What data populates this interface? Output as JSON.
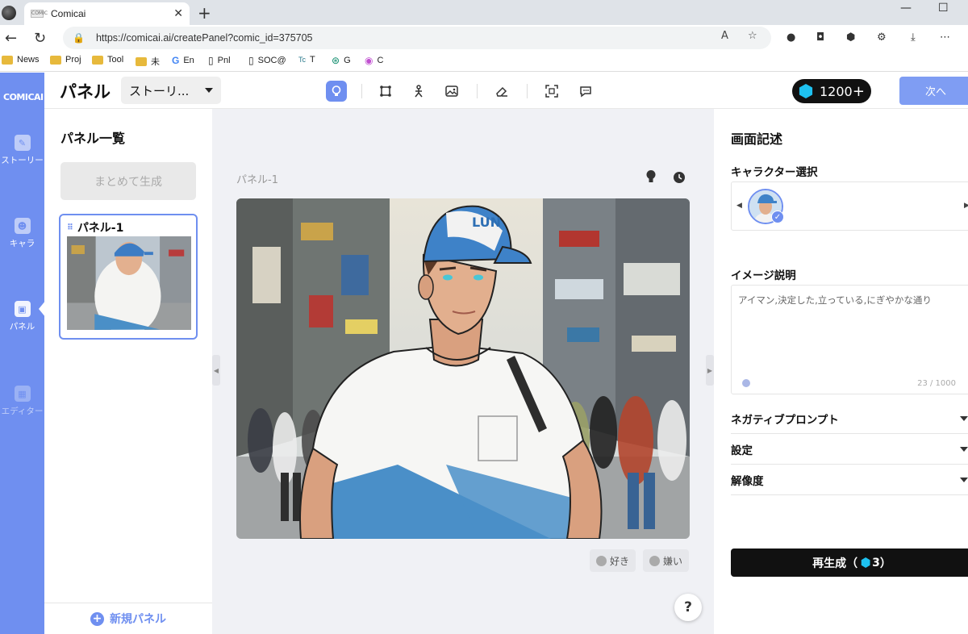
{
  "browser": {
    "tab_title": "Comicai",
    "tab_favicon_text": "COMIC",
    "url": "https://comicai.ai/createPanel?comic_id=375705",
    "bookmarks": [
      {
        "label": "News",
        "icon": "folder-icon"
      },
      {
        "label": "Proj",
        "icon": "folder-icon"
      },
      {
        "label": "Tool",
        "icon": "folder-icon"
      },
      {
        "label": "未",
        "icon": "folder-icon"
      },
      {
        "label": "En",
        "icon": "google-icon"
      },
      {
        "label": "Pnl",
        "icon": "page-icon"
      },
      {
        "label": "SOC@",
        "icon": "page-icon"
      },
      {
        "label": "T",
        "icon": "translate-icon"
      },
      {
        "label": "G",
        "icon": "gpt-icon"
      },
      {
        "label": "C",
        "icon": "copilot-icon"
      }
    ]
  },
  "app": {
    "logo": "COMICAI",
    "rail": [
      {
        "label": "ストーリー",
        "icon": "pencil-icon"
      },
      {
        "label": "キャラ",
        "icon": "character-icon"
      },
      {
        "label": "パネル",
        "icon": "image-icon"
      },
      {
        "label": "エディター",
        "icon": "editor-icon"
      }
    ],
    "page_title": "パネル",
    "story_select": "ストーリ...",
    "credits": "1200",
    "next_button": "次へ",
    "accent": "#6f8ff0"
  },
  "panel_list": {
    "title": "パネル一覧",
    "batch_button": "まとめて生成",
    "items": [
      {
        "label": "パネル-1"
      }
    ],
    "new_panel": "新規パネル"
  },
  "canvas": {
    "panel_label": "パネル-1",
    "like": "好き",
    "dislike": "嫌い",
    "help": "?",
    "cap_text": "LUN"
  },
  "details": {
    "title": "画面記述",
    "character_section": "キャラクター選択",
    "image_desc_section": "イメージ説明",
    "image_desc_text": "アイマン,決定した,立っている,にぎやかな通り",
    "char_count": "23 / 1000",
    "negative_prompt": "ネガティブプロンプト",
    "settings": "設定",
    "resolution": "解像度",
    "regenerate_label": "再生成（",
    "regenerate_cost": "3",
    "regenerate_close": "）"
  }
}
